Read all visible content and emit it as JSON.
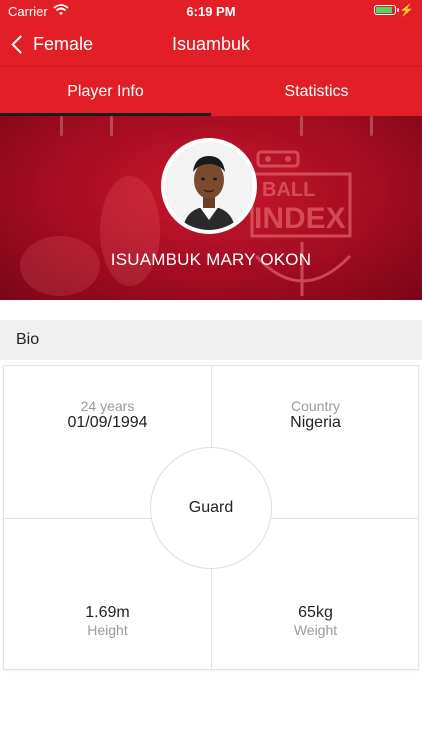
{
  "status_bar": {
    "carrier": "Carrier",
    "time": "6:19 PM",
    "battery_level": 0.9
  },
  "nav": {
    "back_label": "Female",
    "title": "Isuambuk"
  },
  "tabs": [
    {
      "label": "Player Info",
      "active": true
    },
    {
      "label": "Statistics",
      "active": false
    }
  ],
  "player": {
    "name": "ISUAMBUK MARY OKON"
  },
  "logo": {
    "line1": "BALL",
    "line2": "INDEX"
  },
  "bio": {
    "section_title": "Bio",
    "age": "24 years",
    "dob": "01/09/1994",
    "country_label": "Country",
    "country": "Nigeria",
    "position": "Guard",
    "height": "1.69m",
    "height_label": "Height",
    "weight": "65kg",
    "weight_label": "Weight"
  },
  "colors": {
    "brand_red": "#e21f26",
    "tab_indicator": "#1a1a1a",
    "battery_green": "#4cd964"
  }
}
